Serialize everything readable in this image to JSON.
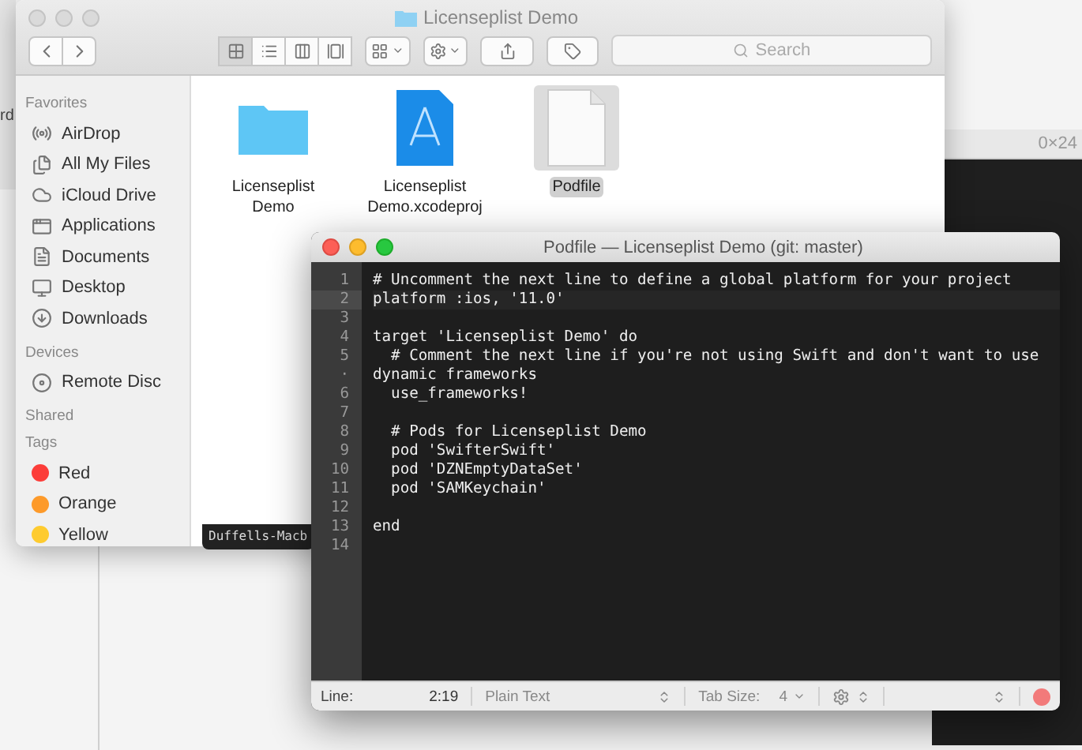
{
  "background": {
    "side_text": "rd",
    "terminal_title": "0×24",
    "terminal_tab": "Duffells-Macb"
  },
  "finder": {
    "title": "Licenseplist Demo",
    "view_modes": [
      {
        "selected": true
      },
      {
        "selected": false
      },
      {
        "selected": false
      },
      {
        "selected": false
      }
    ],
    "search": {
      "placeholder": "Search"
    },
    "sidebar": [
      {
        "heading": "Favorites",
        "items": [
          {
            "label": "AirDrop"
          },
          {
            "label": "All My Files"
          },
          {
            "label": "iCloud Drive"
          },
          {
            "label": "Applications"
          },
          {
            "label": "Documents"
          },
          {
            "label": "Desktop"
          },
          {
            "label": "Downloads"
          }
        ]
      },
      {
        "heading": "Devices",
        "items": [
          {
            "label": "Remote Disc"
          }
        ]
      },
      {
        "heading": "Shared"
      },
      {
        "heading": "Tags",
        "tags": [
          {
            "label": "Red",
            "color": "#fc3d39"
          },
          {
            "label": "Orange",
            "color": "#fd9a2a"
          },
          {
            "label": "Yellow",
            "color": "#fecb2f"
          }
        ]
      }
    ],
    "files": [
      {
        "kind": "folder",
        "name": "Licenseplist Demo",
        "selected": false
      },
      {
        "kind": "project",
        "name": "Licenseplist Demo.xcodeproj",
        "selected": false
      },
      {
        "kind": "document",
        "name": "Podfile",
        "selected": true
      }
    ]
  },
  "editor": {
    "title": "Podfile — Licenseplist Demo (git: master)",
    "lines": [
      {
        "number": "1",
        "text": "# Uncomment the next line to define a global platform for your project",
        "selected": false
      },
      {
        "number": "2",
        "text": "platform :ios, '11.0'",
        "selected": true
      },
      {
        "number": "3",
        "selected": false
      },
      {
        "number": "4",
        "text": "target 'Licenseplist Demo' do",
        "selected": false
      },
      {
        "number": "5",
        "text": "  # Comment the next line if you're not using Swift and don't want to use",
        "selected": false
      },
      {
        "number": "·",
        "text": "dynamic frameworks",
        "selected": false
      },
      {
        "number": "6",
        "text": "  use_frameworks!",
        "selected": false
      },
      {
        "number": "7",
        "selected": false
      },
      {
        "number": "8",
        "text": "  # Pods for Licenseplist Demo",
        "selected": false
      },
      {
        "number": "9",
        "text": "  pod 'SwifterSwift'",
        "selected": false
      },
      {
        "number": "10",
        "text": "  pod 'DZNEmptyDataSet'",
        "selected": false
      },
      {
        "number": "11",
        "text": "  pod 'SAMKeychain'",
        "selected": false
      },
      {
        "number": "12",
        "selected": false
      },
      {
        "number": "13",
        "text": "end",
        "selected": false
      },
      {
        "number": "14",
        "selected": false
      }
    ],
    "status": {
      "line_label": "Line:",
      "position": "2:19",
      "syntax": "Plain Text",
      "tab_label": "Tab Size:",
      "tab_size": "4"
    }
  }
}
